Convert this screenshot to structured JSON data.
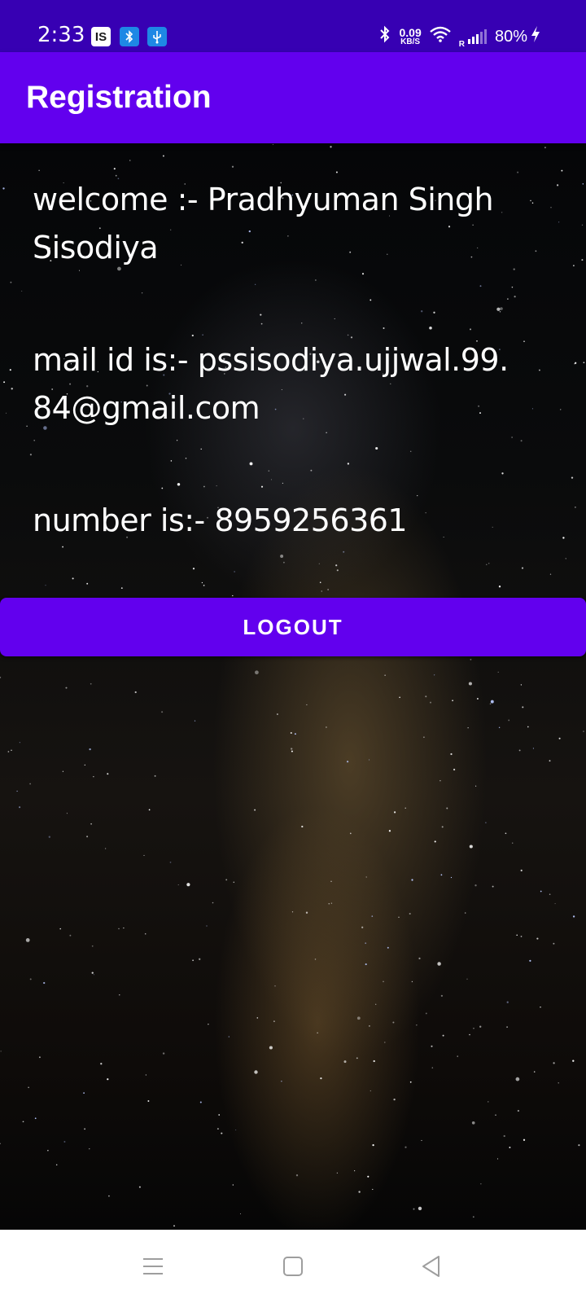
{
  "status_bar": {
    "time": "2:33",
    "notification_icons": [
      "IS",
      "bluetooth-icon",
      "usb-icon"
    ],
    "is_badge_text": "IS",
    "net_speed_value": "0.09",
    "net_speed_unit": "KB/S",
    "roaming_label": "R",
    "battery_percent": "80%",
    "background_color": "#3700b3"
  },
  "app_bar": {
    "title": "Registration",
    "background_color": "#6200ee"
  },
  "profile": {
    "welcome_text": "welcome :- Pradhyuman Singh Sisodiya",
    "mail_text": "mail id is:- pssisodiya.ujjwal.99.84@gmail.com",
    "number_text": "number is:- 8959256361"
  },
  "actions": {
    "logout_label": "LOGOUT",
    "button_color": "#6200ee"
  },
  "nav_bar": {
    "items": [
      "menu-icon",
      "home-icon",
      "back-icon"
    ]
  }
}
